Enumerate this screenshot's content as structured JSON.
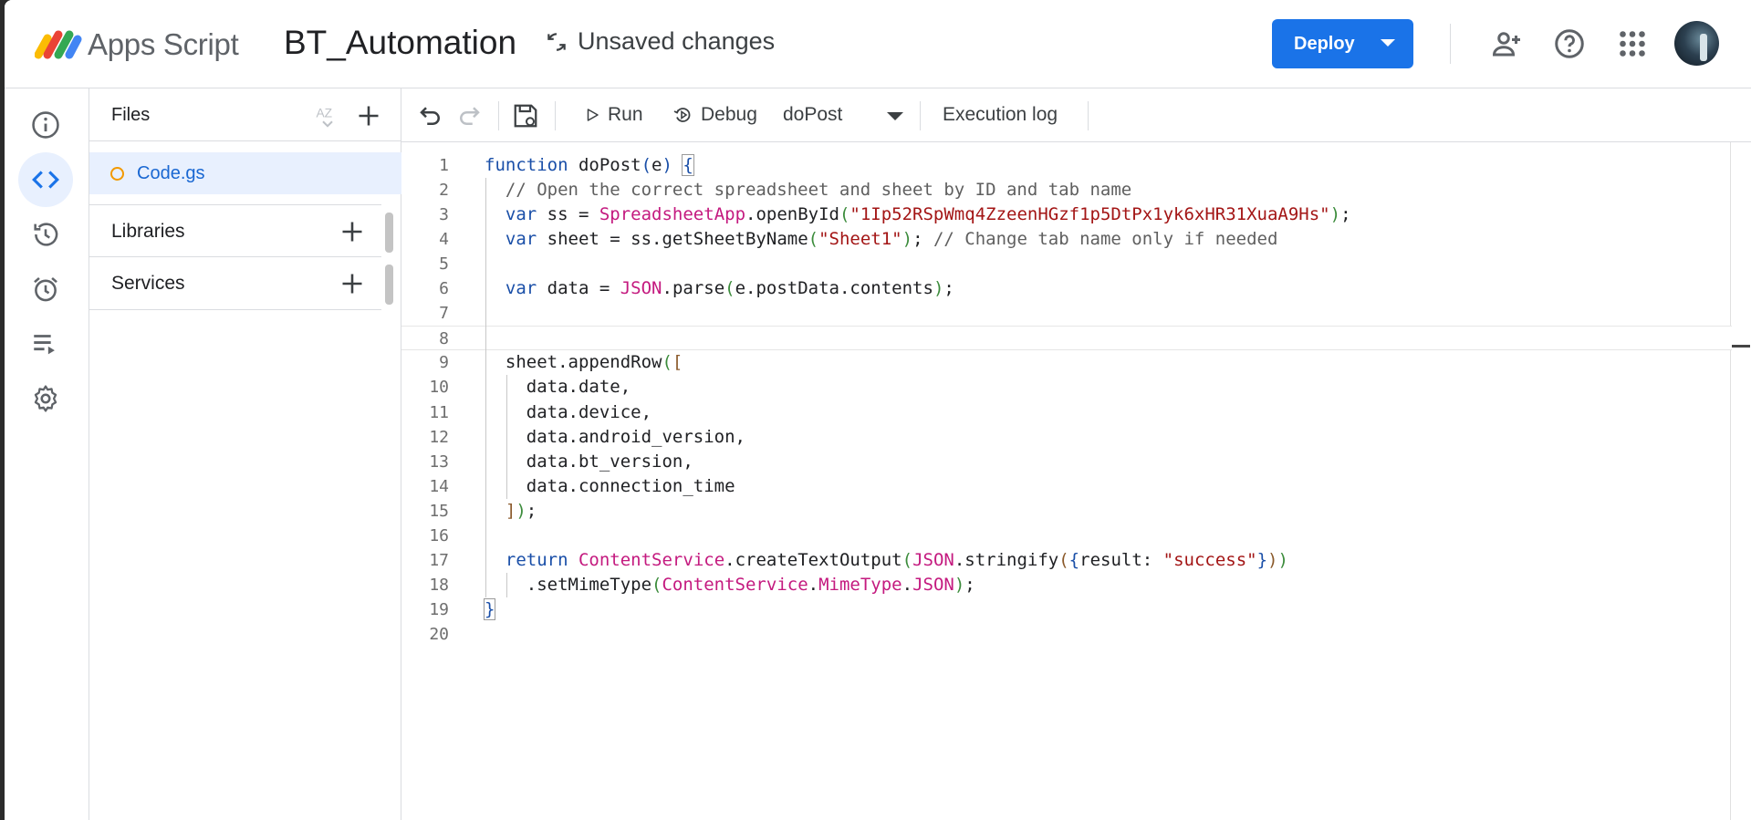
{
  "header": {
    "app_name": "Apps Script",
    "project_name": "BT_Automation",
    "status": "Unsaved changes",
    "deploy_label": "Deploy"
  },
  "files_panel": {
    "title": "Files",
    "files": [
      {
        "name": "Code.gs"
      }
    ],
    "libraries_label": "Libraries",
    "services_label": "Services"
  },
  "toolbar": {
    "run_label": "Run",
    "debug_label": "Debug",
    "function_selected": "doPost",
    "execution_log_label": "Execution log"
  },
  "editor": {
    "current_line": 8,
    "lines": [
      {
        "n": "1",
        "tokens": [
          {
            "t": "function ",
            "c": "kw"
          },
          {
            "t": "doPost",
            "c": ""
          },
          {
            "t": "(",
            "c": "p1"
          },
          {
            "t": "e",
            "c": ""
          },
          {
            "t": ")",
            "c": "p1"
          },
          {
            "t": " ",
            "c": ""
          },
          {
            "t": "{",
            "c": "p1 hl"
          }
        ]
      },
      {
        "n": "2",
        "tokens": [
          {
            "t": "  // Open the correct spreadsheet and sheet by ID and tab name",
            "c": "cmt"
          }
        ]
      },
      {
        "n": "3",
        "tokens": [
          {
            "t": "  ",
            "c": ""
          },
          {
            "t": "var",
            "c": "kw"
          },
          {
            "t": " ss = ",
            "c": ""
          },
          {
            "t": "SpreadsheetApp",
            "c": "cls"
          },
          {
            "t": ".openById",
            "c": ""
          },
          {
            "t": "(",
            "c": "p2"
          },
          {
            "t": "\"1Ip52RSpWmq4ZzeenHGzf1p5DtPx1yk6xHR31XuaA9Hs\"",
            "c": "str"
          },
          {
            "t": ")",
            "c": "p2"
          },
          {
            "t": ";",
            "c": ""
          }
        ]
      },
      {
        "n": "4",
        "tokens": [
          {
            "t": "  ",
            "c": ""
          },
          {
            "t": "var",
            "c": "kw"
          },
          {
            "t": " sheet = ss.getSheetByName",
            "c": ""
          },
          {
            "t": "(",
            "c": "p2"
          },
          {
            "t": "\"Sheet1\"",
            "c": "str"
          },
          {
            "t": ")",
            "c": "p2"
          },
          {
            "t": "; ",
            "c": ""
          },
          {
            "t": "// Change tab name only if needed",
            "c": "cmt"
          }
        ]
      },
      {
        "n": "5",
        "tokens": []
      },
      {
        "n": "6",
        "tokens": [
          {
            "t": "  ",
            "c": ""
          },
          {
            "t": "var",
            "c": "kw"
          },
          {
            "t": " data = ",
            "c": ""
          },
          {
            "t": "JSON",
            "c": "cls"
          },
          {
            "t": ".parse",
            "c": ""
          },
          {
            "t": "(",
            "c": "p2"
          },
          {
            "t": "e.postData.contents",
            "c": ""
          },
          {
            "t": ")",
            "c": "p2"
          },
          {
            "t": ";",
            "c": ""
          }
        ]
      },
      {
        "n": "7",
        "tokens": []
      },
      {
        "n": "8",
        "tokens": []
      },
      {
        "n": "9",
        "tokens": [
          {
            "t": "  sheet.appendRow",
            "c": ""
          },
          {
            "t": "(",
            "c": "p2"
          },
          {
            "t": "[",
            "c": "p3"
          }
        ]
      },
      {
        "n": "10",
        "tokens": [
          {
            "t": "    data.date,",
            "c": ""
          }
        ]
      },
      {
        "n": "11",
        "tokens": [
          {
            "t": "    data.device,",
            "c": ""
          }
        ]
      },
      {
        "n": "12",
        "tokens": [
          {
            "t": "    data.android_version,",
            "c": ""
          }
        ]
      },
      {
        "n": "13",
        "tokens": [
          {
            "t": "    data.bt_version,",
            "c": ""
          }
        ]
      },
      {
        "n": "14",
        "tokens": [
          {
            "t": "    data.connection_time",
            "c": ""
          }
        ]
      },
      {
        "n": "15",
        "tokens": [
          {
            "t": "  ",
            "c": ""
          },
          {
            "t": "]",
            "c": "p3"
          },
          {
            "t": ")",
            "c": "p2"
          },
          {
            "t": ";",
            "c": ""
          }
        ]
      },
      {
        "n": "16",
        "tokens": []
      },
      {
        "n": "17",
        "tokens": [
          {
            "t": "  ",
            "c": ""
          },
          {
            "t": "return",
            "c": "kw"
          },
          {
            "t": " ",
            "c": ""
          },
          {
            "t": "ContentService",
            "c": "cls"
          },
          {
            "t": ".createTextOutput",
            "c": ""
          },
          {
            "t": "(",
            "c": "p2"
          },
          {
            "t": "JSON",
            "c": "cls"
          },
          {
            "t": ".stringify",
            "c": ""
          },
          {
            "t": "(",
            "c": "p3"
          },
          {
            "t": "{",
            "c": "p1"
          },
          {
            "t": "result: ",
            "c": ""
          },
          {
            "t": "\"success\"",
            "c": "str"
          },
          {
            "t": "}",
            "c": "p1"
          },
          {
            "t": ")",
            "c": "p3"
          },
          {
            "t": ")",
            "c": "p2"
          }
        ]
      },
      {
        "n": "18",
        "tokens": [
          {
            "t": "    .setMimeType",
            "c": ""
          },
          {
            "t": "(",
            "c": "p2"
          },
          {
            "t": "ContentService",
            "c": "cls"
          },
          {
            "t": ".",
            "c": ""
          },
          {
            "t": "MimeType",
            "c": "cls"
          },
          {
            "t": ".",
            "c": ""
          },
          {
            "t": "JSON",
            "c": "cls"
          },
          {
            "t": ")",
            "c": "p2"
          },
          {
            "t": ";",
            "c": ""
          }
        ]
      },
      {
        "n": "19",
        "tokens": [
          {
            "t": "}",
            "c": "p1 hl"
          }
        ]
      },
      {
        "n": "20",
        "tokens": []
      }
    ]
  },
  "colors": {
    "accent": "#1a73e8",
    "selected_bg": "#e8f0fe",
    "file_dot": "#f29900"
  }
}
